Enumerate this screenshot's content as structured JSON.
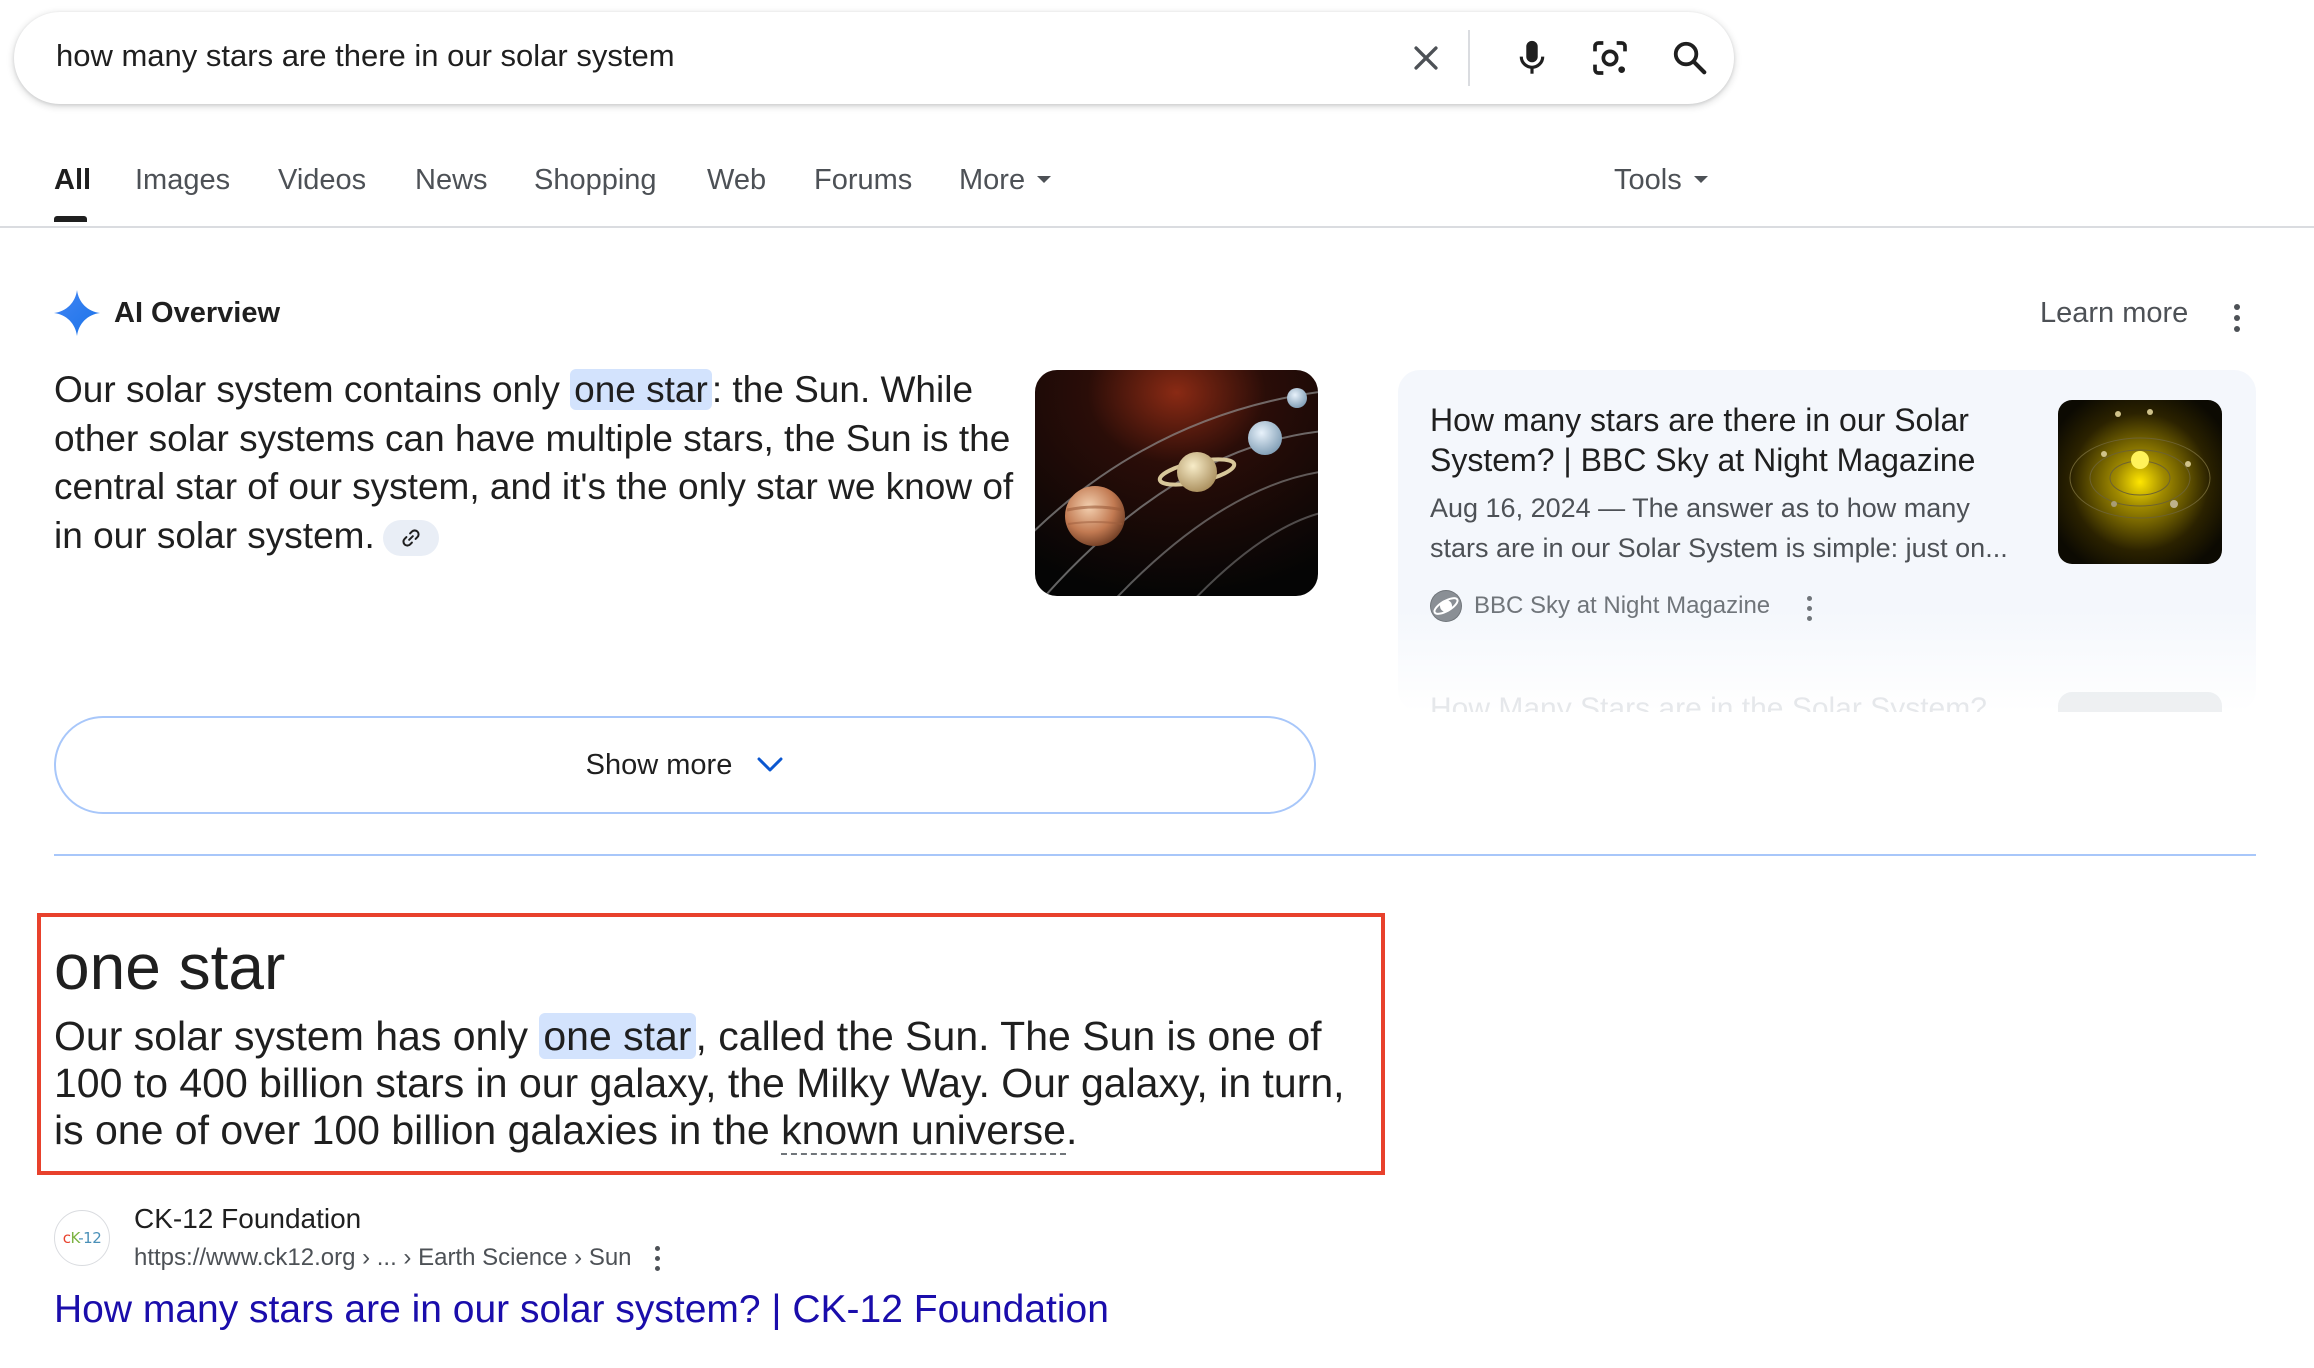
{
  "search": {
    "query": "how many stars are there in our solar system",
    "icons": [
      "close-icon",
      "microphone-icon",
      "camera-lens-icon",
      "search-icon"
    ]
  },
  "tabs": [
    {
      "label": "All",
      "active": true
    },
    {
      "label": "Images"
    },
    {
      "label": "Videos"
    },
    {
      "label": "News"
    },
    {
      "label": "Shopping"
    },
    {
      "label": "Web"
    },
    {
      "label": "Forums"
    },
    {
      "label": "More"
    },
    {
      "label": "Tools"
    }
  ],
  "ai_overview": {
    "title": "AI Overview",
    "learn_more": "Learn more",
    "text_before": "Our solar system contains only ",
    "highlight": "one star",
    "text_after": ": the Sun. While other solar systems can have multiple stars, the Sun is the central star of our system, and it's the only star we know of in our solar system.",
    "show_more": "Show more",
    "source_card": {
      "title": "How many stars are there in our Solar System? | BBC Sky at Night Magazine",
      "snippet": "Aug 16, 2024 — The answer as to how many stars are in our Solar System is simple: just on...",
      "source": "BBC Sky at Night Magazine",
      "next_title_faded": "How Many Stars are in the Solar System?"
    }
  },
  "featured_snippet": {
    "answer": "one star",
    "text_before": "Our solar system has only ",
    "highlight": "one star",
    "text_middle": ", called the Sun. The Sun is one of 100 to 400 billion stars in our galaxy, the Milky Way. Our galaxy, in turn, is one of over 100 billion galaxies in the ",
    "underlined": "known universe",
    "text_end": "."
  },
  "result": {
    "favicon_text": "CK-12",
    "site_name": "CK-12 Foundation",
    "url": "https://www.ck12.org › ... › Earth Science › Sun",
    "title": "How many stars are in our solar system? | CK-12 Foundation"
  },
  "colors": {
    "highlight": "#d3e3fd",
    "link": "#1a0dab",
    "annotation_box": "#e8412c",
    "ai_blue": "#4285f4"
  }
}
